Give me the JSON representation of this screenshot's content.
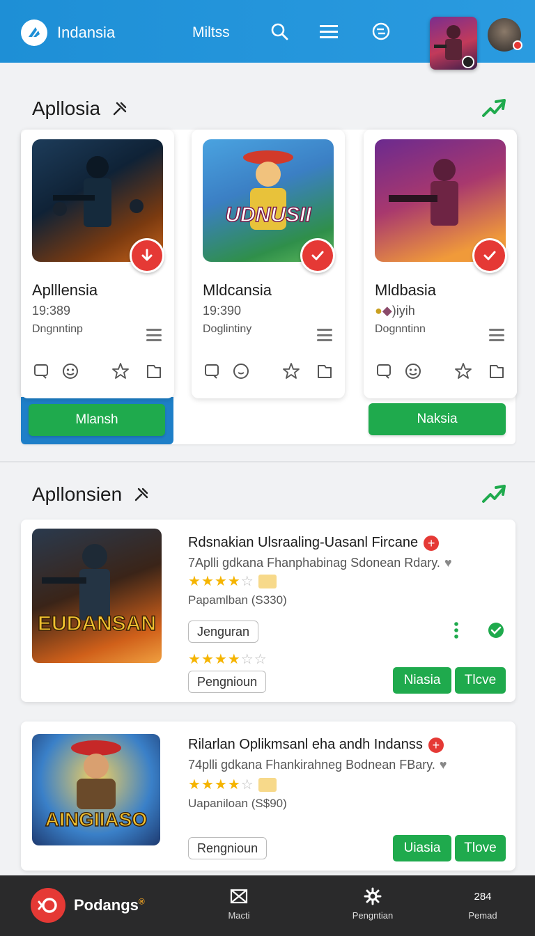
{
  "header": {
    "brand": "Indansia",
    "menu_link": "Miltss"
  },
  "section1": {
    "title": "Apllosia",
    "cards": [
      {
        "title": "Aplllensia",
        "sub": "19:389",
        "meta": "Dngnntinp"
      },
      {
        "title": "Mldcansia",
        "sub": "19:390",
        "meta": "Doglintiny"
      },
      {
        "title": "Mldbasia",
        "sub": ")iyih",
        "meta": "Dognntinn"
      }
    ],
    "buttons": {
      "left": "Mlansh",
      "right": "Naksia"
    }
  },
  "section2": {
    "title": "Apllonsien",
    "items": [
      {
        "title": "Rdsnakian Ulsraaling-Uasanl Fircane",
        "desc": "7Aplli gdkana Fhanphabinag Sdonean Rdary.",
        "price": "Papamlban (S330)",
        "rating": 4,
        "art_text": "EUDANSAN",
        "tags": [
          "Jenguran",
          "Pengnioun"
        ],
        "buttons": [
          "Niasia",
          "Tlcve"
        ]
      },
      {
        "title": "Rilarlan Oplikmsanl eha andh Indanss",
        "desc": "74plli gdkana Fhankirahneg Bodnean FBary.",
        "price": "Uapaniloan (S$90)",
        "rating": 4,
        "art_text": "AINGIIASO",
        "tags": [
          "Rengnioun"
        ],
        "buttons": [
          "Uiasia",
          "Tlove"
        ]
      }
    ]
  },
  "bottom_bar": {
    "brand": "Podangs",
    "brand_sup": "®",
    "items": [
      {
        "label": "Macti",
        "icon": "envelope-x-icon"
      },
      {
        "label": "Pengntian",
        "icon": "gear-icon"
      },
      {
        "label": "Pemad",
        "top": "284"
      }
    ]
  },
  "colors": {
    "header": "#1e8fd6",
    "accent_green": "#1faa4d",
    "badge_red": "#e53935",
    "bottom_bar": "#2a2a2b"
  }
}
